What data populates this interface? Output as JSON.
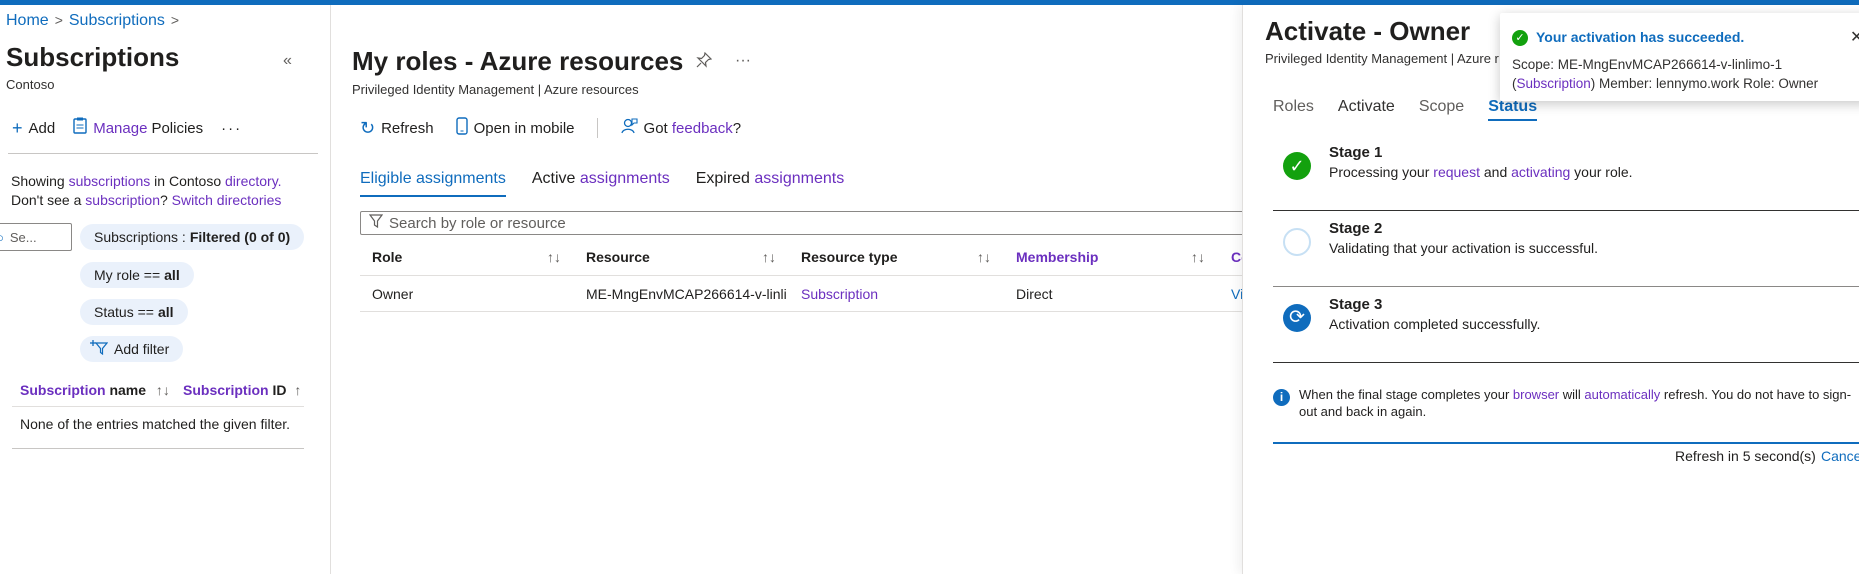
{
  "left": {
    "breadcrumb": [
      "Home",
      "Subscriptions"
    ],
    "title": "Subscriptions",
    "subtitle": "Contoso",
    "collapse": "«",
    "commands": {
      "add": "Add",
      "manage_a": "Manage",
      "manage_b": "Policies",
      "more": "···"
    },
    "showing": {
      "a": "Showing ",
      "b": "subscriptions",
      "c": " in Contoso ",
      "d": "directory.",
      "e": "Don't see a ",
      "f": "subscription",
      "g": "? ",
      "h": "Switch directories"
    },
    "search_placeholder": "Se...",
    "pills": {
      "subs_a": "Subscriptions : ",
      "subs_b": "Filtered (0 of 0)",
      "role_a": "My role == ",
      "role_b": "all",
      "status_a": "Status == ",
      "status_b": "all",
      "add_filter": "Add filter"
    },
    "columns": {
      "name_a": "Subscription",
      "name_b": " name",
      "id_a": "Subscription",
      "id_b": " ID"
    },
    "empty": "None of the entries matched the given filter."
  },
  "middle": {
    "title": "My roles - Azure resources",
    "subtitle": "Privileged Identity Management | Azure resources",
    "commands": {
      "refresh": "Refresh",
      "mobile": "Open in mobile",
      "feedback_a": "Got ",
      "feedback_b": "feedback",
      "feedback_c": "?"
    },
    "tabs": {
      "eligible": "Eligible assignments",
      "active_a": "Active ",
      "active_b": "assignments",
      "expired_a": "Expired ",
      "expired_b": "assignments"
    },
    "search_placeholder": "Search by role or resource",
    "columns": [
      "Role",
      "Resource",
      "Resource type",
      "Membership",
      "Co"
    ],
    "row": {
      "role": "Owner",
      "resource": "ME-MngEnvMCAP266614-v-linli",
      "type": "Subscription",
      "membership": "Direct",
      "action": "Vi"
    }
  },
  "panel": {
    "title": "Activate - Owner",
    "subtitle": "Privileged Identity Management | Azure r",
    "tabs": [
      "Roles",
      "Activate",
      "Scope",
      "Status"
    ],
    "stages": [
      {
        "title": "Stage 1",
        "d1": "Processing your ",
        "d2": "request",
        "d3": " and ",
        "d4": "activating",
        "d5": " your role."
      },
      {
        "title": "Stage 2",
        "desc": "Validating that your activation is successful."
      },
      {
        "title": "Stage 3",
        "desc": "Activation completed successfully."
      }
    ],
    "info": {
      "a": "When the final stage completes your ",
      "b": "browser",
      "c": " will ",
      "d": "automatically",
      "e": " refresh. You do not have to sign-out and back in again."
    },
    "refresh_text": "Refresh in 5 second(s)",
    "cancel": "Cance"
  },
  "toast": {
    "title": "Your activation has succeeded.",
    "l1": "Scope: ME-MngEnvMCAP266614-v-linlimo-1",
    "l2a": "(",
    "l2b": "Subscription",
    "l2c": ") Member: lennymo.work Role: Owner"
  },
  "colors": {
    "accent": "#0f6cbd",
    "link": "#6b2fbf",
    "success": "#13a10e"
  }
}
